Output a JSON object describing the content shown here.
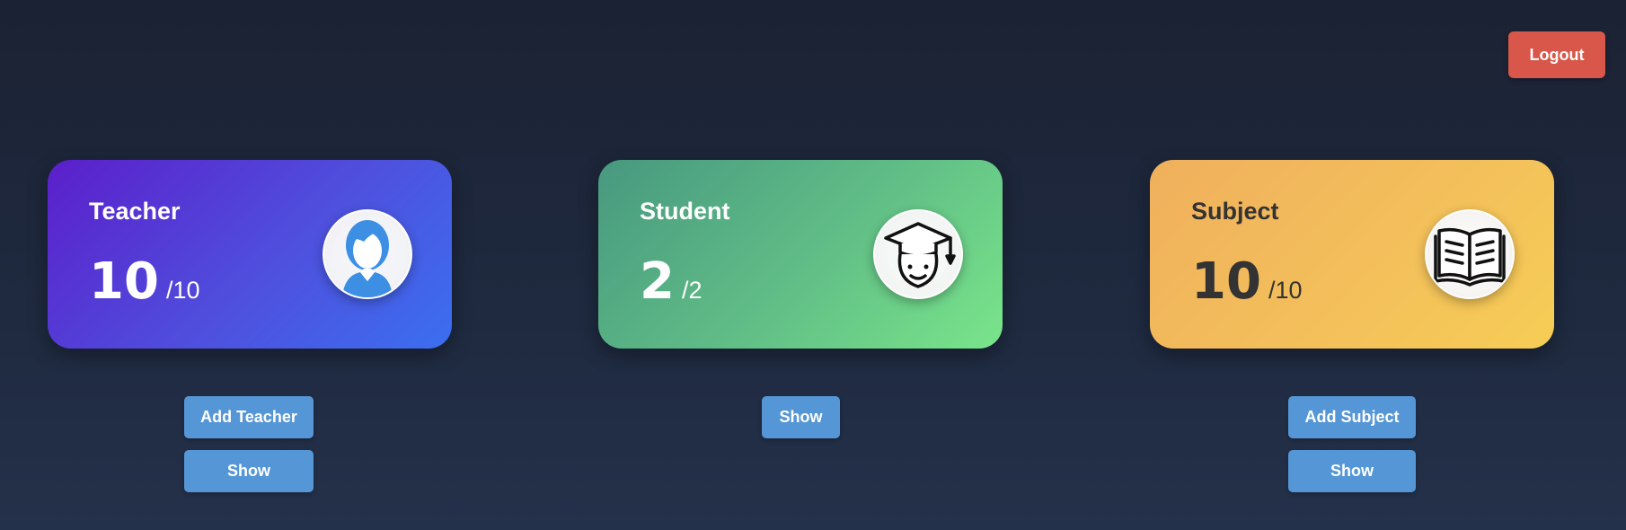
{
  "header": {
    "logout_label": "Logout"
  },
  "colors": {
    "logout": "#d9574a",
    "button": "#5596d6",
    "teacher_gradient": [
      "#5b1fcb",
      "#3b6ff0"
    ],
    "student_gradient": [
      "#47997f",
      "#79e58a"
    ],
    "subject_gradient": [
      "#f0b05c",
      "#f6cd55"
    ]
  },
  "cards": [
    {
      "title": "Teacher",
      "count": "10",
      "total": "/10",
      "icon": "teacher-avatar-icon",
      "buttons": [
        "Add Teacher",
        "Show"
      ]
    },
    {
      "title": "Student",
      "count": "2",
      "total": "/2",
      "icon": "graduate-student-icon",
      "buttons": [
        "Show"
      ]
    },
    {
      "title": "Subject",
      "count": "10",
      "total": "/10",
      "icon": "open-book-icon",
      "buttons": [
        "Add Subject",
        "Show"
      ]
    }
  ]
}
